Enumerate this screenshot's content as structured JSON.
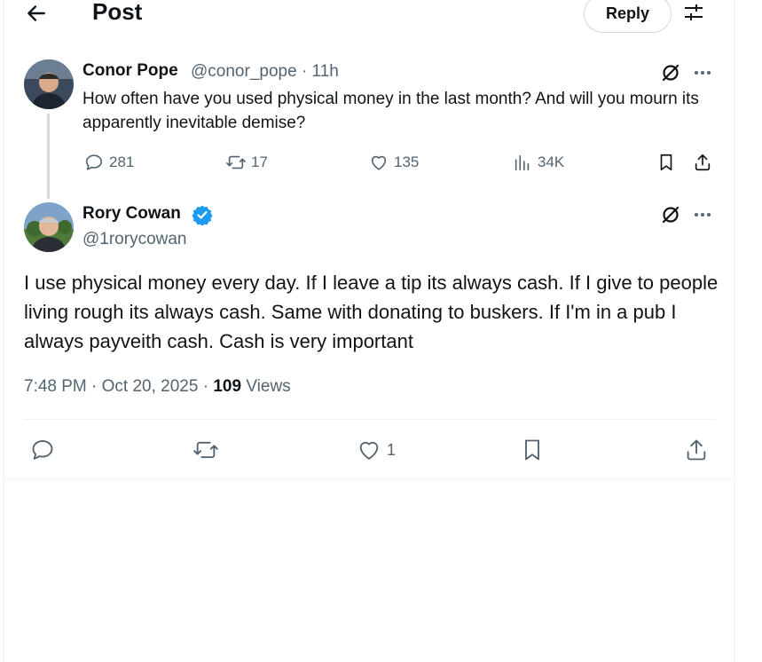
{
  "header": {
    "title": "Post",
    "reply_label": "Reply"
  },
  "parent_tweet": {
    "author_name": "Conor Pope",
    "author_handle": "@conor_pope",
    "separator": "·",
    "time": "11h",
    "text": "How often have you used physical money in the last month? And will you mourn its apparently inevitable demise?",
    "replies": "281",
    "reposts": "17",
    "likes": "135",
    "views": "34K"
  },
  "main_tweet": {
    "author_name": "Rory Cowan",
    "author_handle": "@1rorycowan",
    "text": "I use physical money every day. If I leave a tip its always cash. If I give to people living rough its always cash. Same with donating to buskers. If I'm in a pub I always payveith cash. Cash is very important",
    "timestamp": "7:48 PM · Oct 20, 2025",
    "meta_sep": "·",
    "views_count": "109",
    "views_label": "Views",
    "likes": "1"
  },
  "colors": {
    "text_primary": "#0f1419",
    "text_secondary": "#536471",
    "verified": "#1d9bf0",
    "border": "#eff3f4"
  },
  "icons": [
    "back-arrow-icon",
    "filter-icon",
    "grok-icon",
    "more-icon",
    "reply-icon",
    "repost-icon",
    "like-icon",
    "views-icon",
    "bookmark-icon",
    "share-icon",
    "verified-icon"
  ]
}
